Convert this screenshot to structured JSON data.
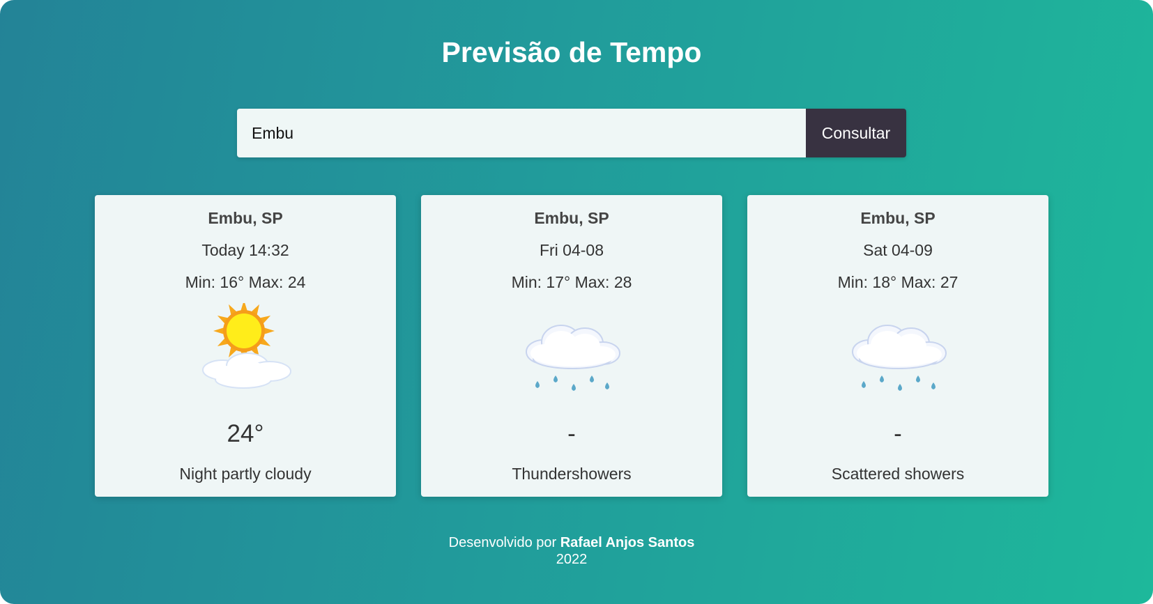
{
  "header": {
    "title": "Previsão de Tempo"
  },
  "search": {
    "value": "Embu",
    "button_label": "Consultar"
  },
  "cards": [
    {
      "city": "Embu, SP",
      "date": "Today 14:32",
      "minmax": "Min: 16° Max: 24",
      "temp": "24°",
      "description": "Night partly cloudy",
      "icon": "sun-cloud-icon"
    },
    {
      "city": "Embu, SP",
      "date": "Fri 04-08",
      "minmax": "Min: 17° Max: 28",
      "temp": "-",
      "description": "Thundershowers",
      "icon": "rain-cloud-icon"
    },
    {
      "city": "Embu, SP",
      "date": "Sat 04-09",
      "minmax": "Min: 18° Max: 27",
      "temp": "-",
      "description": "Scattered showers",
      "icon": "rain-cloud-icon"
    }
  ],
  "footer": {
    "prefix": "Desenvolvido por",
    "author": "Rafael Anjos Santos",
    "year": "2022"
  },
  "colors": {
    "bg_start": "#238397",
    "bg_end": "#1eb89b",
    "button": "#383241",
    "card": "#eff6f6"
  }
}
